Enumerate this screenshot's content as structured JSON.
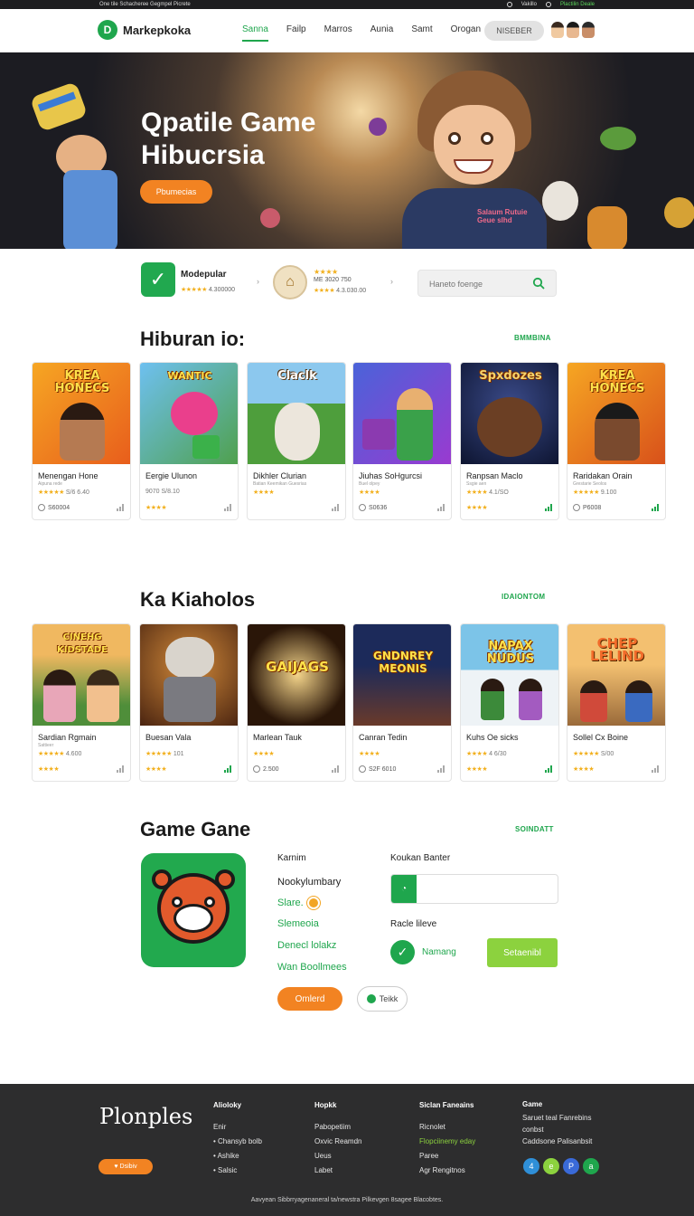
{
  "topbar": {
    "left_text": "One tile Schacheree Gegmpel Picrete",
    "right_link": "Vakillo",
    "right_green": "Plactilin Deale"
  },
  "header": {
    "logo_text": "Markepkoka",
    "nav": [
      "Sanna",
      "Failp",
      "Marros",
      "Aunia",
      "Samt",
      "Orogan"
    ],
    "active_nav": "Sanna",
    "search_label": "NISEBER"
  },
  "hero": {
    "title": "Qpatile Game Hibucrsia",
    "button": "Pbumecias",
    "shirt_text": "Salaum Rutuie Geue slhd"
  },
  "strip": {
    "app1_name": "Modepular",
    "app1_rating": "4.300000",
    "app2_line1": "ME 3020 750",
    "app2_line2": "4.3.030.00",
    "search_placeholder": "Haneto foenge"
  },
  "section1": {
    "title": "Hiburan io:",
    "link": "BMMBINA",
    "cards": [
      {
        "thumb": "KREA HONECS",
        "name": "Menengan Hone",
        "sub": "Aipuna rede",
        "rating": "S/6 6.40",
        "foot": "S60004",
        "bar": "gray"
      },
      {
        "thumb": "WANTIC",
        "name": "Eergie Ulunon",
        "sub": "",
        "rating": "9070 S/8.10",
        "foot": "",
        "bar": "gray"
      },
      {
        "thumb": "Claclk",
        "name": "Dikhler Clurian",
        "sub": "Batian Keemikan Guesrias",
        "rating": "",
        "foot": "",
        "bar": "gray"
      },
      {
        "thumb": "",
        "name": "Jiuhas SoHgurcsi",
        "sub": "Buel olpey",
        "rating": "",
        "foot": "S0636",
        "bar": "gray"
      },
      {
        "thumb": "Spxdozes",
        "name": "Ranpsan Maclo",
        "sub": "Ssgie aen",
        "rating": "4.1/SO",
        "foot": "",
        "bar": "green"
      },
      {
        "thumb": "KREA HONECS",
        "name": "Raridakan Orain",
        "sub": "Grestarie Seolos",
        "rating": "9.100",
        "foot": "P6008",
        "bar": "green"
      }
    ]
  },
  "section2": {
    "title": "Ka Kiaholos",
    "link": "IDAIONTOM",
    "cards": [
      {
        "thumb": "CINEHG KIDSTADE",
        "name": "Sardian Rgmain",
        "sub": "Sattieer",
        "rating": "4.600",
        "foot": "",
        "bar": "gray"
      },
      {
        "thumb": "",
        "name": "Buesan Vala",
        "sub": "",
        "rating": "101",
        "foot": "",
        "bar": "green"
      },
      {
        "thumb": "GAIJAGS",
        "name": "Marlean Tauk",
        "sub": "",
        "rating": "",
        "foot": "2.500",
        "bar": "gray"
      },
      {
        "thumb": "GNDNREY MEONIS",
        "name": "Canran Tedin",
        "sub": "",
        "rating": "",
        "foot": "S2F 6010",
        "bar": "gray"
      },
      {
        "thumb": "NAPAX NUDUS",
        "name": "Kuhs Oe sicks",
        "sub": "",
        "rating": "4 6/30",
        "foot": "",
        "bar": "green"
      },
      {
        "thumb": "CHEP LELIND",
        "name": "Sollel Cx Boine",
        "sub": "",
        "rating": "S/00",
        "foot": "",
        "bar": "gray"
      }
    ]
  },
  "section3": {
    "title": "Game Gane",
    "link": "SOINDATT",
    "col1": {
      "label": "Karnim",
      "line1": "Nookylumbary",
      "line2": "Slare.",
      "line3": "Slemeoia",
      "line4": "Denecl lolakz",
      "line5": "Wan Boollmees"
    },
    "col2": {
      "label1": "Koukan Banter",
      "label2": "Racle lileve",
      "check_text": "Namang",
      "lime_button": "Setaenibl"
    },
    "orange_button": "Omlerd",
    "outline_button": "Teikk"
  },
  "footer": {
    "logo": "Plonples",
    "badge": "Dsibiv",
    "col1": {
      "head": "Alioloky",
      "items": [
        "Enir",
        "Chansyb bolb",
        "Ashike",
        "Salsic"
      ]
    },
    "col2": {
      "head": "Hopkk",
      "items": [
        "Pabopetiim",
        "Oxvic Reamdn",
        "Ueus",
        "Labet"
      ]
    },
    "col3": {
      "head": "Siclan Faneains",
      "items": [
        "Ricnolet",
        "Flopciinemy eday",
        "Paree",
        "Agr Rengitnos"
      ]
    },
    "col4": {
      "head": "Game",
      "items": [
        "Saruet teal Fanrebins",
        "conbst",
        "Caddsone Palisanbsit"
      ]
    },
    "social": [
      "4",
      "e",
      "P",
      "a"
    ],
    "copyright": "Aavyean Sibbrryagenaneral ta/newstra Pilkevgen 8sagee Blacobtes."
  },
  "colors": {
    "brand_green": "#1fa64d",
    "accent_orange": "#f28322",
    "lime": "#8cd23e",
    "footer_bg": "#2d2d2e"
  }
}
